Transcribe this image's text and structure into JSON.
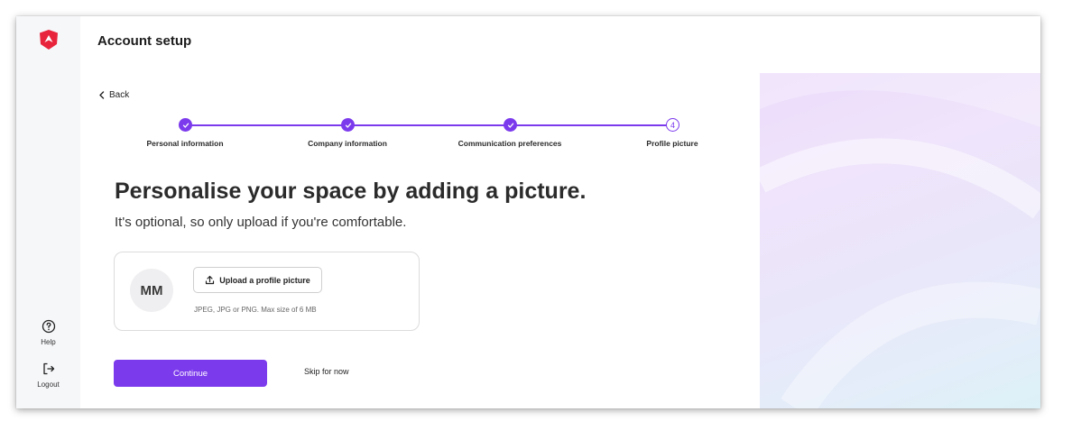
{
  "app": {
    "title": "Account setup"
  },
  "sidebar": {
    "help_label": "Help",
    "logout_label": "Logout"
  },
  "nav": {
    "back_label": "Back"
  },
  "stepper": {
    "steps": [
      {
        "label": "Personal information",
        "status": "complete"
      },
      {
        "label": "Company information",
        "status": "complete"
      },
      {
        "label": "Communication preferences",
        "status": "complete"
      },
      {
        "label": "Profile picture",
        "status": "current",
        "number": "4"
      }
    ]
  },
  "main": {
    "headline": "Personalise your space by adding a picture.",
    "subline": "It's optional, so only upload if you're comfortable."
  },
  "upload": {
    "avatar_initials": "MM",
    "button_label": "Upload a profile picture",
    "hint": "JPEG, JPG or PNG. Max size of 6 MB"
  },
  "actions": {
    "continue_label": "Continue",
    "skip_label": "Skip for now"
  },
  "colors": {
    "accent": "#7c3aed",
    "logo": "#e8243c"
  },
  "icons": [
    "shield-logo-icon",
    "help-circle-icon",
    "logout-icon",
    "chevron-left-icon",
    "check-icon",
    "upload-icon"
  ]
}
